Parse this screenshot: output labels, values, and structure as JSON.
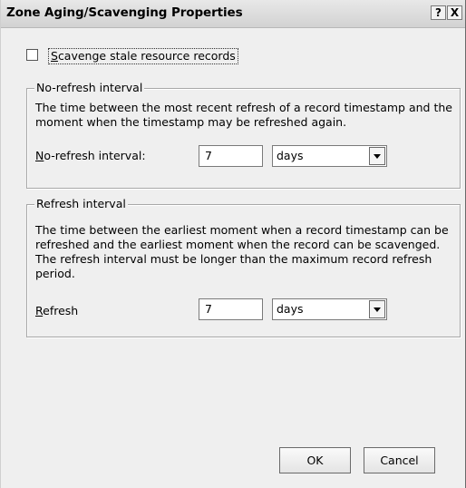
{
  "window": {
    "title": "Zone Aging/Scavenging Properties",
    "help_label": "?",
    "close_label": "X"
  },
  "scavenge": {
    "checked": false,
    "label_mnemonic": "S",
    "label_rest": "cavenge stale resource records"
  },
  "no_refresh": {
    "group_title": "No-refresh interval",
    "description": "The time between the most recent refresh of a record timestamp and the moment when the timestamp may be refreshed again.",
    "field_label_mnemonic": "N",
    "field_label_rest": "o-refresh interval:",
    "value": "7",
    "unit": "days"
  },
  "refresh": {
    "group_title": "Refresh interval",
    "description": "The time between the earliest moment when a record timestamp can be refreshed and the earliest moment when the record can be scavenged. The refresh interval must be longer than the maximum record refresh period.",
    "field_label_mnemonic": "R",
    "field_label_rest": "efresh",
    "value": "7",
    "unit": "days"
  },
  "buttons": {
    "ok_label": "OK",
    "cancel_label": "Cancel"
  }
}
